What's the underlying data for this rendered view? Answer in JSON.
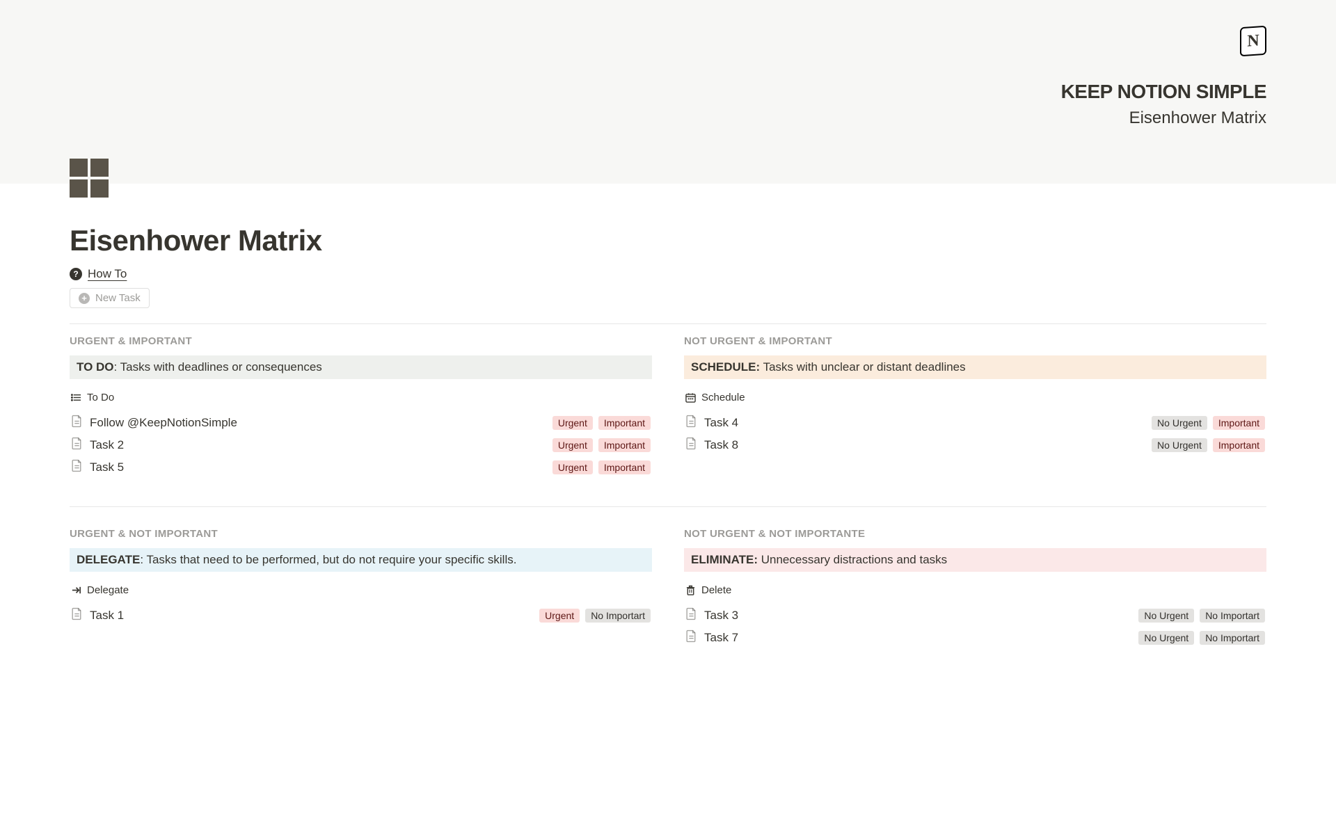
{
  "header": {
    "logo_char": "N",
    "title": "KEEP NOTION SIMPLE",
    "subtitle": "Eisenhower Matrix"
  },
  "page": {
    "title": "Eisenhower Matrix",
    "how_to": "How To",
    "new_task": "New Task"
  },
  "quadrants": {
    "todo": {
      "heading": "URGENT & IMPORTANT",
      "callout_label": "TO DO",
      "callout_sep": ": ",
      "callout_text": "Tasks with deadlines or consequences",
      "view_label": "To Do",
      "tasks": [
        {
          "title": "Follow @KeepNotionSimple",
          "tag1": "Urgent",
          "tag2": "Important"
        },
        {
          "title": "Task 2",
          "tag1": "Urgent",
          "tag2": "Important"
        },
        {
          "title": "Task 5",
          "tag1": "Urgent",
          "tag2": "Important"
        }
      ]
    },
    "schedule": {
      "heading": "NOT URGENT & IMPORTANT",
      "callout_label": "SCHEDULE:",
      "callout_sep": " ",
      "callout_text": "Tasks with unclear or distant deadlines",
      "view_label": "Schedule",
      "tasks": [
        {
          "title": "Task 4",
          "tag1": "No Urgent",
          "tag2": "Important"
        },
        {
          "title": "Task 8",
          "tag1": "No Urgent",
          "tag2": "Important"
        }
      ]
    },
    "delegate": {
      "heading": "URGENT & NOT IMPORTANT",
      "callout_label": "DELEGATE",
      "callout_sep": ": ",
      "callout_text": "Tasks that need to be performed, but do not require your specific skills.",
      "view_label": "Delegate",
      "tasks": [
        {
          "title": "Task 1",
          "tag1": "Urgent",
          "tag2": "No Importart"
        }
      ]
    },
    "eliminate": {
      "heading": "NOT URGENT & NOT IMPORTANTE",
      "callout_label": "ELIMINATE:",
      "callout_sep": " ",
      "callout_text": "Unnecessary distractions and tasks",
      "view_label": "Delete",
      "tasks": [
        {
          "title": "Task 3",
          "tag1": "No Urgent",
          "tag2": "No Importart"
        },
        {
          "title": "Task 7",
          "tag1": "No Urgent",
          "tag2": "No Importart"
        }
      ]
    }
  },
  "tag_classes": {
    "Urgent": "tag-urgent",
    "No Urgent": "tag-no-urgent",
    "Important": "tag-important",
    "No Importart": "tag-no-important"
  }
}
